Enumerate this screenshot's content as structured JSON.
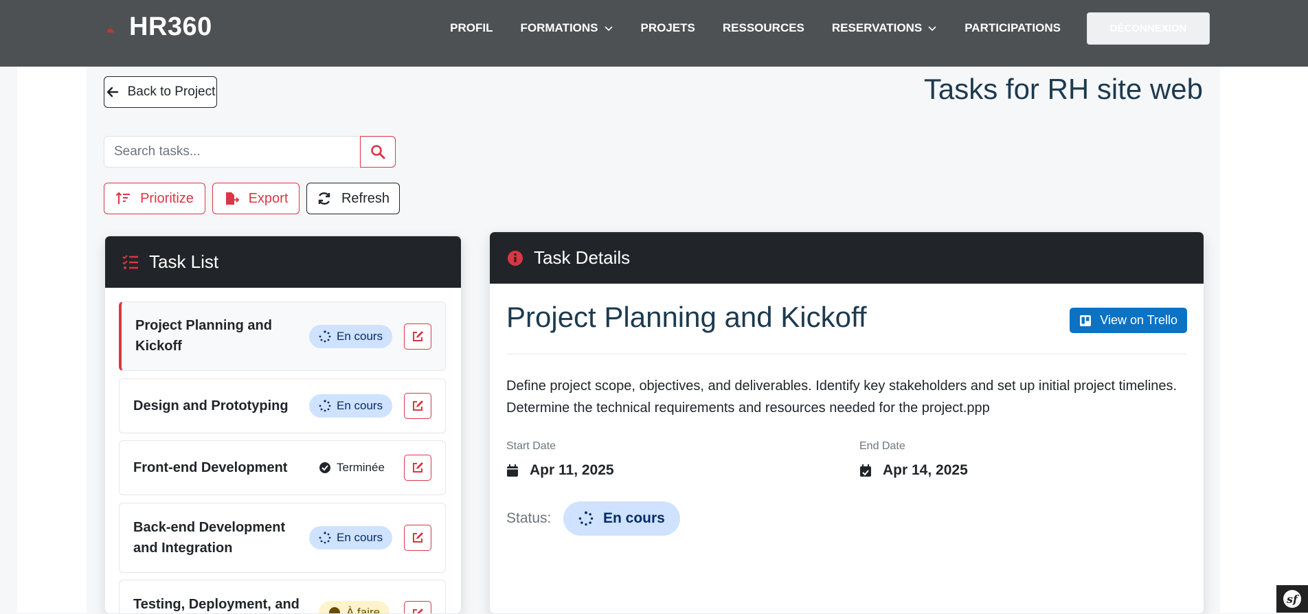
{
  "brand": {
    "name": "HR360",
    "logo_icon": "flame-logo-icon"
  },
  "nav": {
    "items": [
      {
        "label": "PROFIL",
        "dropdown": false
      },
      {
        "label": "FORMATIONS",
        "dropdown": true
      },
      {
        "label": "PROJETS",
        "dropdown": false
      },
      {
        "label": "RESSOURCES",
        "dropdown": false
      },
      {
        "label": "RESERVATIONS",
        "dropdown": true
      },
      {
        "label": "PARTICIPATIONS",
        "dropdown": false
      }
    ],
    "logout_label": "DÉCONNEXION"
  },
  "page": {
    "back_label": "Back to Project",
    "title": "Tasks for RH site web",
    "search_placeholder": "Search tasks...",
    "actions": {
      "prioritize": "Prioritize",
      "export": "Export",
      "refresh": "Refresh"
    }
  },
  "task_list": {
    "header": "Task List",
    "items": [
      {
        "name": "Project Planning and Kickoff",
        "status": "En cours",
        "status_type": "in-progress",
        "active": true
      },
      {
        "name": "Design and Prototyping",
        "status": "En cours",
        "status_type": "in-progress",
        "active": false
      },
      {
        "name": "Front-end Development",
        "status": "Terminée",
        "status_type": "done",
        "active": false
      },
      {
        "name": "Back-end Development and Integration",
        "status": "En cours",
        "status_type": "in-progress",
        "active": false
      },
      {
        "name": "Testing, Deployment, and",
        "status": "À faire",
        "status_type": "todo",
        "active": false
      }
    ]
  },
  "details": {
    "header": "Task Details",
    "title": "Project Planning and Kickoff",
    "trello_label": "View on Trello",
    "description": "Define project scope, objectives, and deliverables. Identify key stakeholders and set up initial project timelines. Determine the technical requirements and resources needed for the project.ppp",
    "start_label": "Start Date",
    "start_value": "Apr 11, 2025",
    "end_label": "End Date",
    "end_value": "Apr 14, 2025",
    "status_label": "Status:",
    "status_value": "En cours"
  },
  "colors": {
    "accent": "#dc3545",
    "navbar": "#4e5154",
    "dark": "#212529",
    "info_badge": "#cfe2ff",
    "trello": "#0b72c4"
  }
}
